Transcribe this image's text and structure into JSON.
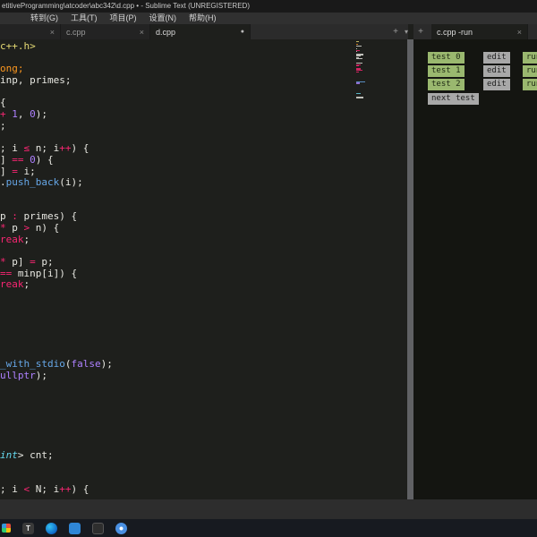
{
  "window": {
    "title": "etitiveProgramming\\atcoder\\abc342\\d.cpp •  - Sublime Text (UNREGISTERED)",
    "menu_items": [
      "转到(G)",
      "工具(T)",
      "项目(P)",
      "设置(N)",
      "帮助(H)"
    ]
  },
  "icons": {
    "close": "×",
    "add": "+",
    "modified": "●",
    "overflow": "▾"
  },
  "tabs": {
    "left": [
      {
        "label": "",
        "modified": false,
        "active": false
      },
      {
        "label": "c.cpp",
        "modified": false,
        "active": false
      },
      {
        "label": "d.cpp",
        "modified": true,
        "active": true
      }
    ],
    "right": [
      {
        "label": "c.cpp -run",
        "modified": false,
        "active": true
      }
    ]
  },
  "editor": {
    "lines": [
      [
        [
          "c++.h>",
          "y"
        ]
      ],
      [],
      [
        [
          "ong;",
          "o"
        ]
      ],
      [
        [
          "inp, primes;",
          "d"
        ]
      ],
      [],
      [
        [
          "{",
          "d"
        ]
      ],
      [
        [
          "+",
          "k"
        ],
        [
          " ",
          "d"
        ],
        [
          "1",
          "n"
        ],
        [
          ", ",
          "d"
        ],
        [
          "0",
          "n"
        ],
        [
          ");",
          "d"
        ]
      ],
      [
        [
          ";",
          "d"
        ]
      ],
      [],
      [
        [
          "; i ",
          "d"
        ],
        [
          "≤",
          "k"
        ],
        [
          " n; i",
          "d"
        ],
        [
          "++",
          "k"
        ],
        [
          ") {",
          "d"
        ]
      ],
      [
        [
          "] ",
          "d"
        ],
        [
          "==",
          "k"
        ],
        [
          " ",
          "d"
        ],
        [
          "0",
          "n"
        ],
        [
          ") {",
          "d"
        ]
      ],
      [
        [
          "] ",
          "d"
        ],
        [
          "=",
          "k"
        ],
        [
          " i;",
          "d"
        ]
      ],
      [
        [
          ".",
          "d"
        ],
        [
          "push_back",
          "f"
        ],
        [
          "(i);",
          "d"
        ]
      ],
      [],
      [],
      [
        [
          "p ",
          "d"
        ],
        [
          ":",
          "k"
        ],
        [
          " primes) {",
          "d"
        ]
      ],
      [
        [
          "*",
          "k"
        ],
        [
          " p ",
          "d"
        ],
        [
          ">",
          "k"
        ],
        [
          " n) {",
          "d"
        ]
      ],
      [
        [
          "reak",
          "k"
        ],
        [
          ";",
          "d"
        ]
      ],
      [],
      [
        [
          "*",
          "k"
        ],
        [
          " p] ",
          "d"
        ],
        [
          "=",
          "k"
        ],
        [
          " p;",
          "d"
        ]
      ],
      [
        [
          "==",
          "k"
        ],
        [
          " minp[i]) {",
          "d"
        ]
      ],
      [
        [
          "reak",
          "k"
        ],
        [
          ";",
          "d"
        ]
      ],
      [],
      [],
      [],
      [],
      [],
      [],
      [
        [
          "_with_stdio",
          "f"
        ],
        [
          "(",
          "d"
        ],
        [
          "false",
          "n"
        ],
        [
          ");",
          "d"
        ]
      ],
      [
        [
          "ullptr",
          "n"
        ],
        [
          ");",
          "d"
        ]
      ],
      [],
      [],
      [],
      [],
      [],
      [],
      [
        [
          "int",
          "t"
        ],
        [
          "> cnt;",
          "d"
        ]
      ],
      [],
      [],
      [
        [
          "; i ",
          "d"
        ],
        [
          "<",
          "k"
        ],
        [
          " N; i",
          "d"
        ],
        [
          "++",
          "k"
        ],
        [
          ") {",
          "d"
        ]
      ]
    ]
  },
  "tests": {
    "rows": [
      {
        "name": "test 0"
      },
      {
        "name": "test 1"
      },
      {
        "name": "test 2"
      }
    ],
    "edit_label": "edit",
    "run_label": "run",
    "next_label": "next test"
  },
  "taskbar": {
    "items": [
      {
        "name": "widget-icon",
        "type": "widget"
      },
      {
        "name": "typora-icon",
        "type": "typora",
        "glyph": "T"
      },
      {
        "name": "edge-icon",
        "type": "edge"
      },
      {
        "name": "vscode-icon",
        "type": "vscode"
      },
      {
        "name": "terminal-icon",
        "type": "terminal"
      },
      {
        "name": "browser-icon",
        "type": "browser"
      }
    ]
  },
  "colors": {
    "editor_bg": "#1e1f1c",
    "token_default": "#e8e8e2",
    "token_keyword": "#f92672",
    "token_number": "#ae81ff",
    "token_function": "#66a7e8",
    "token_type": "#66d9ef",
    "token_string": "#e6db74",
    "token_orange": "#fd971f",
    "test_green": "#9ab86f",
    "test_gray": "#a8a8a8"
  }
}
